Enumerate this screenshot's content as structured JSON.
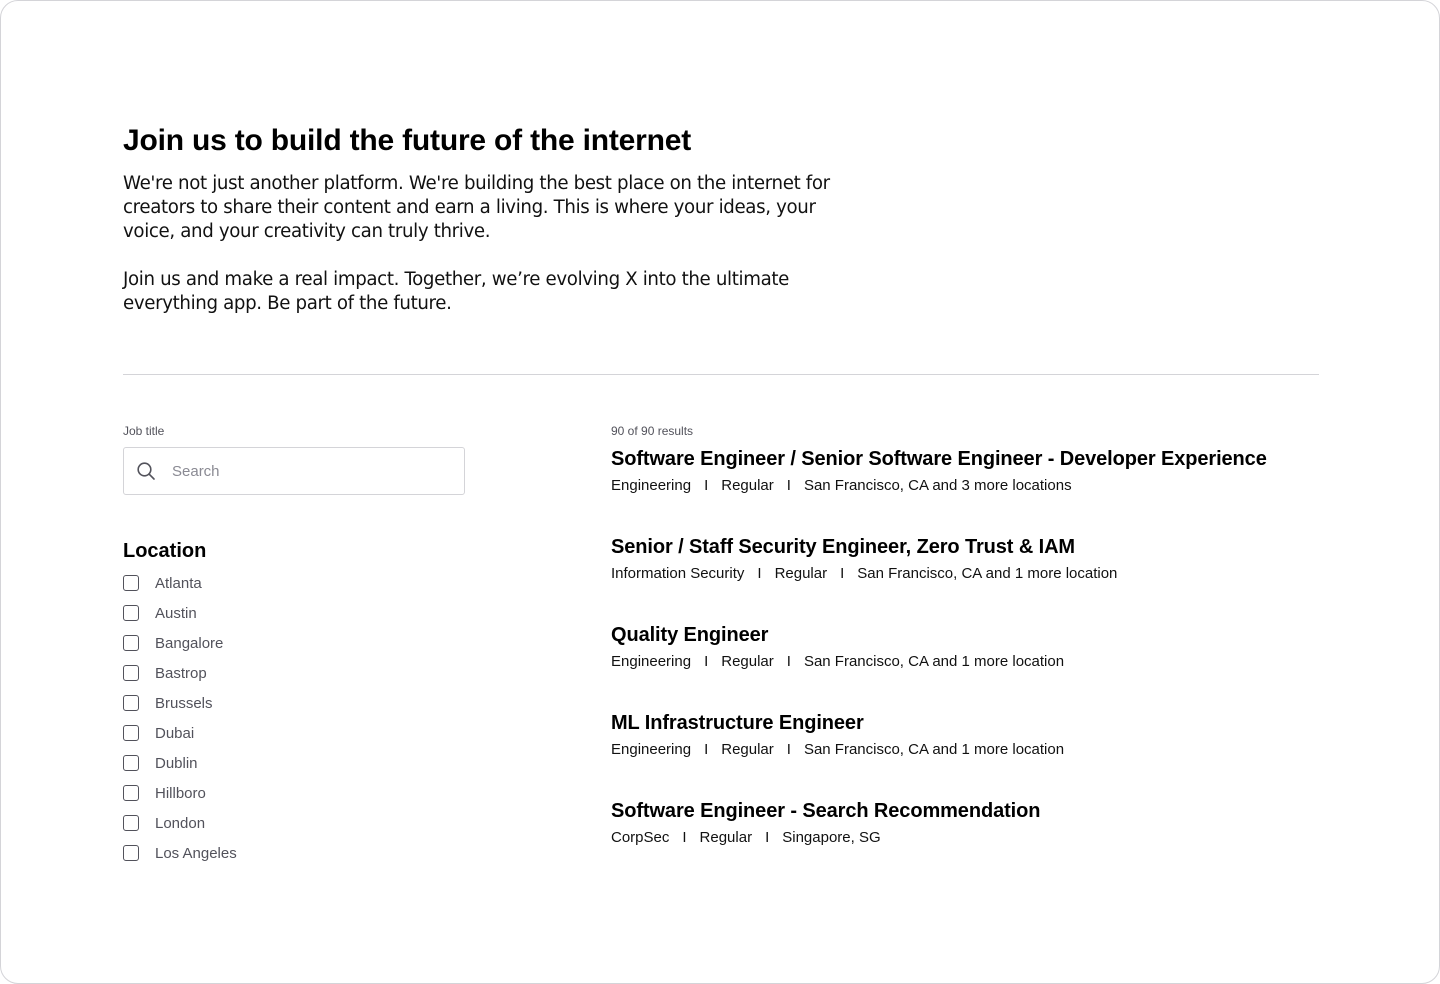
{
  "hero": {
    "title": "Join us to build the future of the internet",
    "paragraph1": "We're not just another platform. We're building the best place on the internet for creators to share their content and earn a living. This is where your ideas, your voice, and your creativity can truly thrive.",
    "paragraph2": "Join us and make a real impact. Together, we’re evolving X into the ultimate everything app. Be part of the future."
  },
  "filters": {
    "job_title_label": "Job title",
    "search_placeholder": "Search",
    "search_icon": "search-icon",
    "location_heading": "Location",
    "locations": [
      "Atlanta",
      "Austin",
      "Bangalore",
      "Bastrop",
      "Brussels",
      "Dubai",
      "Dublin",
      "Hillboro",
      "London",
      "Los Angeles"
    ]
  },
  "results": {
    "count_text": "90 of 90 results",
    "separator": "I",
    "jobs": [
      {
        "title": "Software Engineer / Senior Software Engineer - Developer Experience",
        "team": "Engineering",
        "type": "Regular",
        "location": "San Francisco, CA and 3 more locations"
      },
      {
        "title": "Senior / Staff Security Engineer, Zero Trust & IAM",
        "team": "Information Security",
        "type": "Regular",
        "location": "San Francisco, CA and 1 more location"
      },
      {
        "title": "Quality Engineer",
        "team": "Engineering",
        "type": "Regular",
        "location": "San Francisco, CA and 1 more location"
      },
      {
        "title": "ML Infrastructure Engineer",
        "team": "Engineering",
        "type": "Regular",
        "location": "San Francisco, CA and 1 more location"
      },
      {
        "title": "Software Engineer - Search Recommendation",
        "team": "CorpSec",
        "type": "Regular",
        "location": "Singapore, SG"
      }
    ]
  }
}
